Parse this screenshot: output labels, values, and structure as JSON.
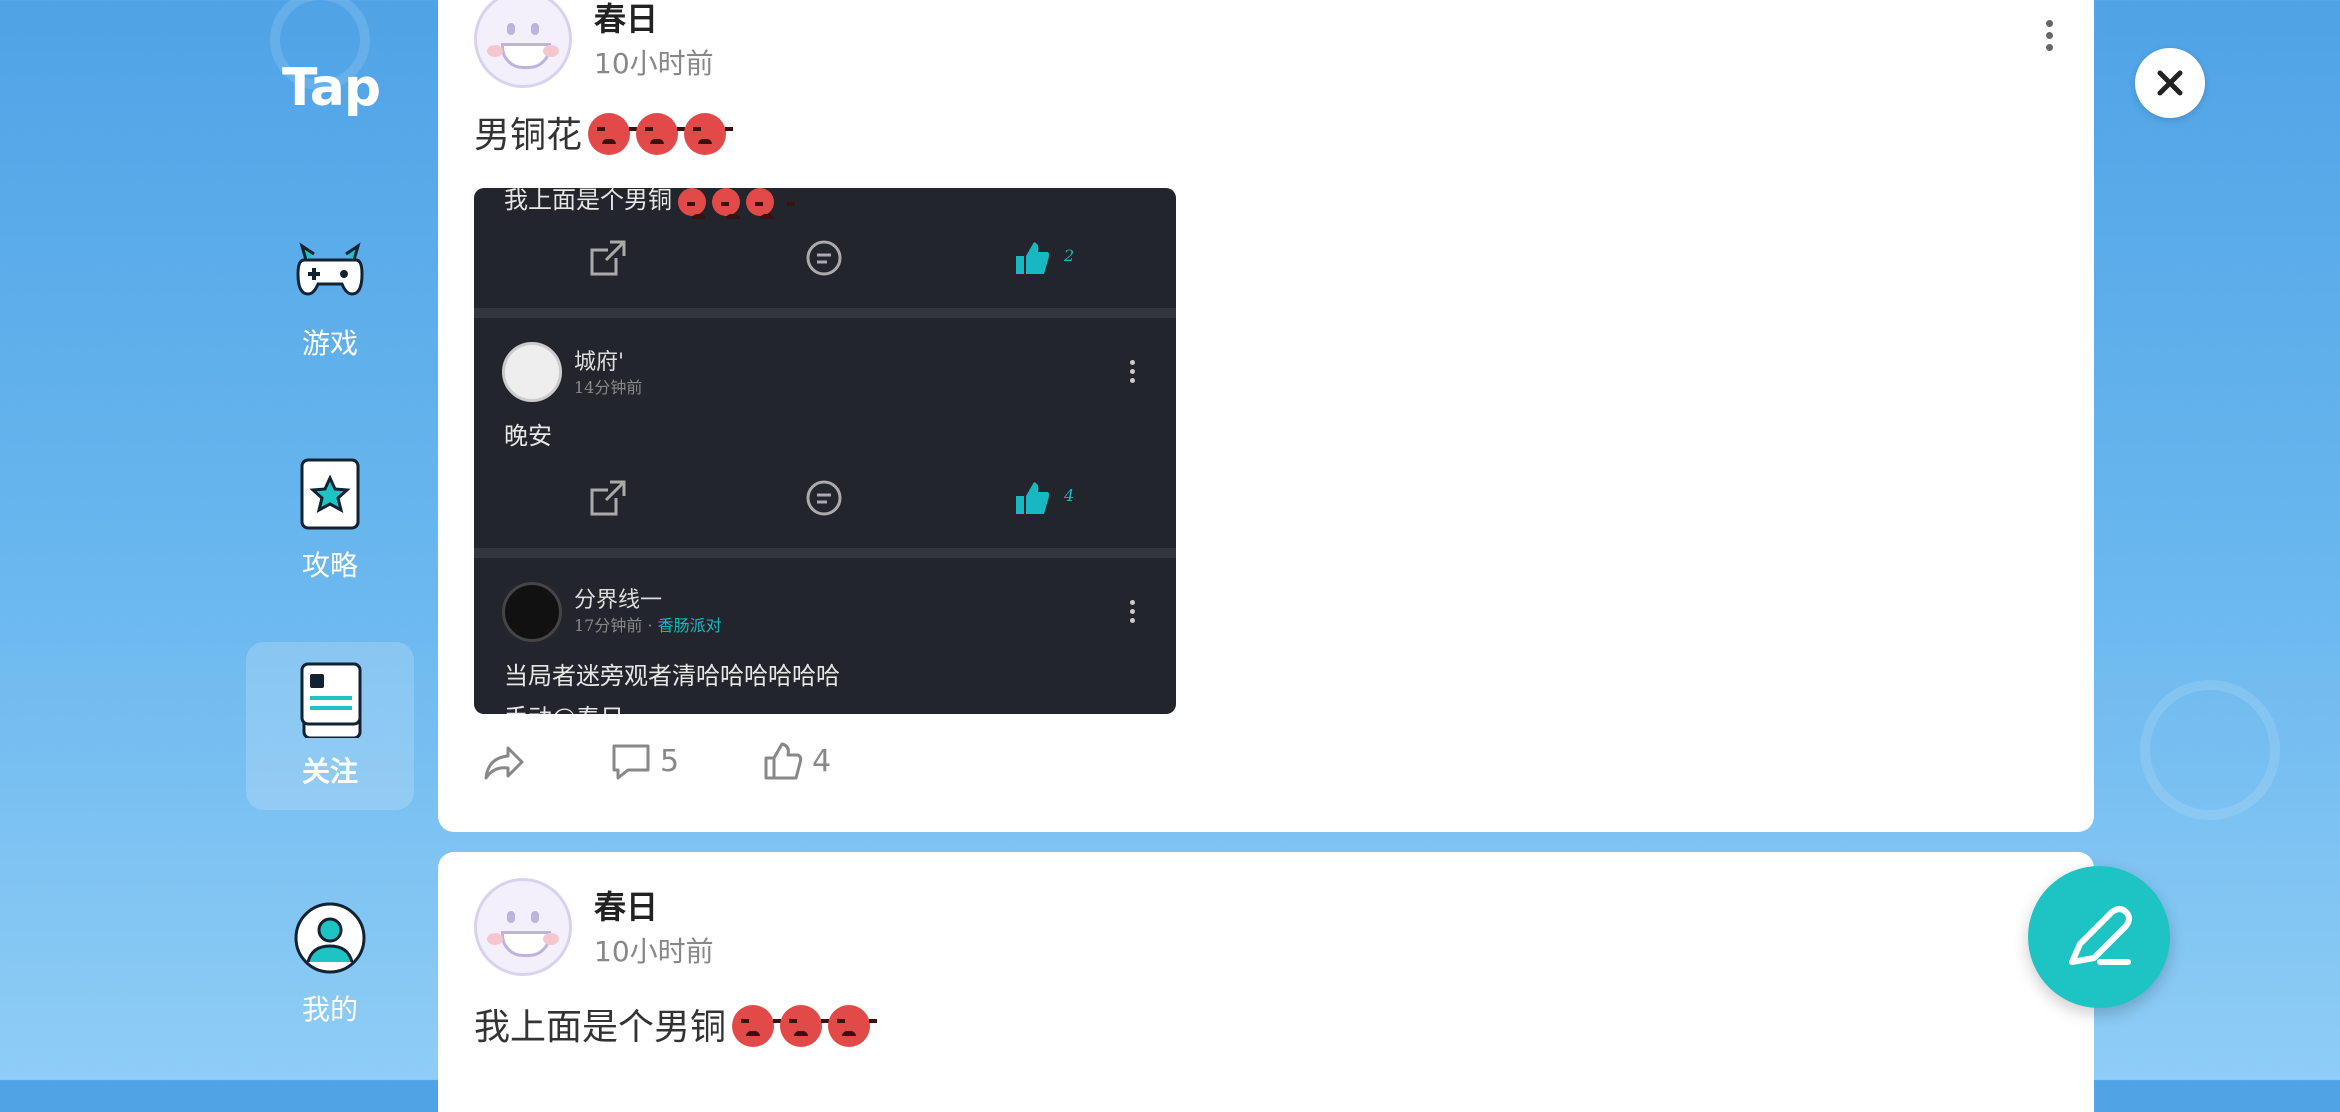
{
  "sidebar": {
    "logo": "Tap",
    "items": [
      {
        "label": "游戏",
        "icon": "gamepad-icon",
        "active": false
      },
      {
        "label": "攻略",
        "icon": "star-card-icon",
        "active": false
      },
      {
        "label": "关注",
        "icon": "feed-icon",
        "active": true
      },
      {
        "label": "我的",
        "icon": "user-icon",
        "active": false
      }
    ]
  },
  "posts": [
    {
      "author": "春日",
      "time": "10小时前",
      "text": "男铜花",
      "emoji_count": 3,
      "actions": {
        "share_icon": "share-icon",
        "comments": "5",
        "likes": "4"
      },
      "screenshot": {
        "top_text": "我上面是个男铜",
        "row1_likes": "2",
        "comment1": {
          "name": "城府'",
          "time": "14分钟前",
          "text": "晚安",
          "likes": "4"
        },
        "comment2": {
          "name": "分界线一",
          "time": "17分钟前 ·",
          "tag": "香肠派对",
          "text": "当局者迷旁观者清哈哈哈哈哈哈",
          "extra": "手动@春日"
        }
      }
    },
    {
      "author": "春日",
      "time": "10小时前",
      "text": "我上面是个男铜",
      "emoji_count": 3
    }
  ],
  "colors": {
    "accent": "#1ec4c4",
    "background": "#4fa3e6",
    "card": "#ffffff",
    "screenshot_bg": "#23252c"
  },
  "buttons": {
    "close_icon": "close-icon",
    "compose_icon": "pen-icon"
  }
}
